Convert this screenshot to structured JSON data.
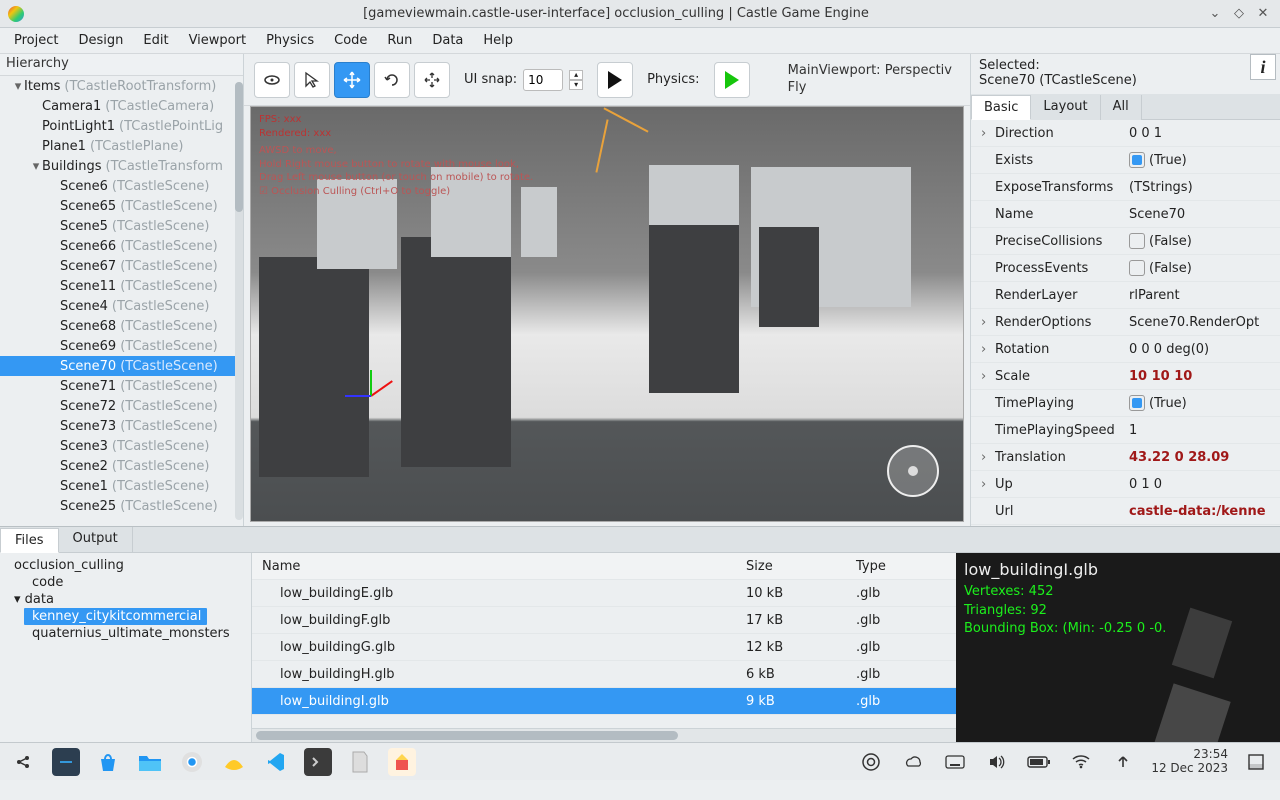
{
  "window": {
    "title": "[gameviewmain.castle-user-interface] occlusion_culling | Castle Game Engine"
  },
  "menu": [
    "Project",
    "Design",
    "Edit",
    "Viewport",
    "Physics",
    "Code",
    "Run",
    "Data",
    "Help"
  ],
  "hierarchy": {
    "header": "Hierarchy",
    "nodes": [
      {
        "d": 0,
        "tw": "▾",
        "name": "Items",
        "klass": "(TCastleRootTransform)"
      },
      {
        "d": 1,
        "tw": "",
        "name": "Camera1",
        "klass": "(TCastleCamera)"
      },
      {
        "d": 1,
        "tw": "",
        "name": "PointLight1",
        "klass": "(TCastlePointLig"
      },
      {
        "d": 1,
        "tw": "",
        "name": "Plane1",
        "klass": "(TCastlePlane)"
      },
      {
        "d": 1,
        "tw": "▾",
        "name": "Buildings",
        "klass": "(TCastleTransform"
      },
      {
        "d": 2,
        "tw": "",
        "name": "Scene6",
        "klass": "(TCastleScene)"
      },
      {
        "d": 2,
        "tw": "",
        "name": "Scene65",
        "klass": "(TCastleScene)"
      },
      {
        "d": 2,
        "tw": "",
        "name": "Scene5",
        "klass": "(TCastleScene)"
      },
      {
        "d": 2,
        "tw": "",
        "name": "Scene66",
        "klass": "(TCastleScene)"
      },
      {
        "d": 2,
        "tw": "",
        "name": "Scene67",
        "klass": "(TCastleScene)"
      },
      {
        "d": 2,
        "tw": "",
        "name": "Scene11",
        "klass": "(TCastleScene)"
      },
      {
        "d": 2,
        "tw": "",
        "name": "Scene4",
        "klass": "(TCastleScene)"
      },
      {
        "d": 2,
        "tw": "",
        "name": "Scene68",
        "klass": "(TCastleScene)"
      },
      {
        "d": 2,
        "tw": "",
        "name": "Scene69",
        "klass": "(TCastleScene)"
      },
      {
        "d": 2,
        "tw": "",
        "name": "Scene70",
        "klass": "(TCastleScene)",
        "sel": true
      },
      {
        "d": 2,
        "tw": "",
        "name": "Scene71",
        "klass": "(TCastleScene)"
      },
      {
        "d": 2,
        "tw": "",
        "name": "Scene72",
        "klass": "(TCastleScene)"
      },
      {
        "d": 2,
        "tw": "",
        "name": "Scene73",
        "klass": "(TCastleScene)"
      },
      {
        "d": 2,
        "tw": "",
        "name": "Scene3",
        "klass": "(TCastleScene)"
      },
      {
        "d": 2,
        "tw": "",
        "name": "Scene2",
        "klass": "(TCastleScene)"
      },
      {
        "d": 2,
        "tw": "",
        "name": "Scene1",
        "klass": "(TCastleScene)"
      },
      {
        "d": 2,
        "tw": "",
        "name": "Scene25",
        "klass": "(TCastleScene)"
      }
    ]
  },
  "toolbar": {
    "snap_label": "UI snap:",
    "snap_value": "10",
    "physics_label": "Physics:",
    "viewport_line1": "MainViewport: Perspectiv",
    "viewport_line2": "Fly"
  },
  "viewport_overlay": {
    "l1": "FPS: xxx",
    "l2": "Rendered: xxx",
    "l3": "AWSD to move,",
    "l4": "Hold Right mouse button to rotate with mouse look,",
    "l5": "Drag Left mouse button (or touch on mobile) to rotate.",
    "l6": "☑ Occlusion Culling (Ctrl+O to toggle)"
  },
  "inspector": {
    "sel_label": "Selected:",
    "sel_value": "Scene70 (TCastleScene)",
    "tabs": [
      "Basic",
      "Layout",
      "All"
    ],
    "active_tab": 0,
    "props": [
      {
        "exp": "›",
        "name": "Direction",
        "val": "0 0 1"
      },
      {
        "name": "Exists",
        "val": "(True)",
        "chk": true
      },
      {
        "name": "ExposeTransforms",
        "val": "(TStrings)"
      },
      {
        "name": "Name",
        "val": "Scene70"
      },
      {
        "name": "PreciseCollisions",
        "val": "(False)",
        "chk": false
      },
      {
        "name": "ProcessEvents",
        "val": "(False)",
        "chk": false
      },
      {
        "name": "RenderLayer",
        "val": "rlParent"
      },
      {
        "exp": "›",
        "name": "RenderOptions",
        "val": "Scene70.RenderOpt"
      },
      {
        "exp": "›",
        "name": "Rotation",
        "val": "0 0 0 deg(0)"
      },
      {
        "exp": "›",
        "name": "Scale",
        "val": "10 10 10",
        "bold": true
      },
      {
        "name": "TimePlaying",
        "val": "(True)",
        "chk": true
      },
      {
        "name": "TimePlayingSpeed",
        "val": "1"
      },
      {
        "exp": "›",
        "name": "Translation",
        "val": "43.22 0 28.09",
        "bold": true
      },
      {
        "exp": "›",
        "name": "Up",
        "val": "0 1 0"
      },
      {
        "name": "Url",
        "val": "castle-data:/kenne",
        "bold": true
      }
    ]
  },
  "bottom": {
    "tabs": [
      "Files",
      "Output"
    ],
    "active_tab": 0,
    "dirs": [
      {
        "d": 0,
        "name": "occlusion_culling"
      },
      {
        "d": 1,
        "name": "code"
      },
      {
        "d": 0,
        "tw": "▾",
        "name": "data"
      },
      {
        "d": 1,
        "name": "kenney_citykitcommercial",
        "sel": true
      },
      {
        "d": 1,
        "name": "quaternius_ultimate_monsters"
      }
    ],
    "cols": {
      "name": "Name",
      "size": "Size",
      "type": "Type"
    },
    "rows": [
      {
        "name": "low_buildingE.glb",
        "size": "10 kB",
        "type": ".glb"
      },
      {
        "name": "low_buildingF.glb",
        "size": "17 kB",
        "type": ".glb"
      },
      {
        "name": "low_buildingG.glb",
        "size": "12 kB",
        "type": ".glb"
      },
      {
        "name": "low_buildingH.glb",
        "size": "6 kB",
        "type": ".glb"
      },
      {
        "name": "low_buildingI.glb",
        "size": "9 kB",
        "type": ".glb",
        "sel": true
      }
    ],
    "preview": {
      "filename": "low_buildingI.glb",
      "l1": "Vertexes: 452",
      "l2": "Triangles: 92",
      "l3": "Bounding Box: (Min: -0.25 0 -0."
    }
  },
  "taskbar": {
    "time": "23:54",
    "date": "12 Dec 2023"
  }
}
